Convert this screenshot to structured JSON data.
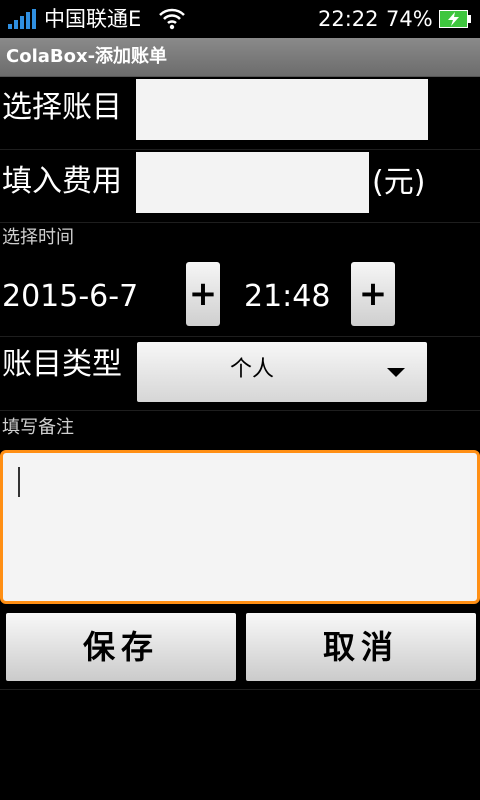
{
  "status_bar": {
    "carrier": "中国联通E",
    "time": "22:22",
    "battery_percent": "74%",
    "icons": [
      "signal-icon",
      "wifi-icon",
      "battery-charging-icon"
    ]
  },
  "titlebar": {
    "title": "ColaBox-添加账单"
  },
  "form": {
    "account_label": "选择账目",
    "account_value": "",
    "amount_label": "填入费用",
    "amount_value": "",
    "amount_unit": "(元)",
    "time_section_label": "选择时间",
    "date_value": "2015-6-7",
    "date_stepper_label": "+",
    "time_value": "21:48",
    "time_stepper_label": "+",
    "type_label": "账目类型",
    "type_selected": "个人",
    "notes_section_label": "填写备注",
    "notes_value": ""
  },
  "actions": {
    "save_label": "保存",
    "cancel_label": "取消"
  },
  "colors": {
    "accent_focus": "#ff8f14",
    "signal": "#2f8fe0",
    "battery": "#3ec63e"
  }
}
